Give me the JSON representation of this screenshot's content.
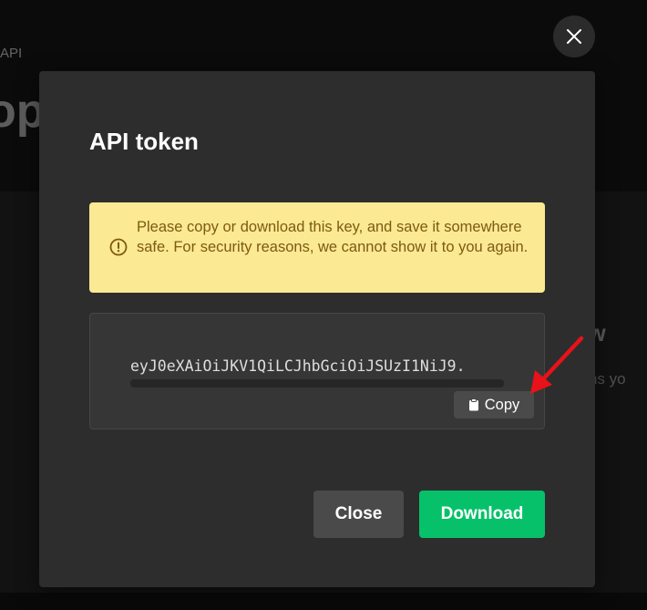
{
  "background": {
    "breadcrumb": "API",
    "big_title": "ope",
    "side_heading": "ow",
    "side_text": "kens yo"
  },
  "modal": {
    "title": "API token",
    "warning": "Please copy or download this key, and save it somewhere safe. For security reasons, we cannot show it to you again.",
    "token": "eyJ0eXAiOiJKV1QiLCJhbGciOiJSUzI1NiJ9.",
    "copy_label": "Copy",
    "close_label": "Close",
    "download_label": "Download"
  },
  "colors": {
    "warning_bg": "#fbe994",
    "warning_text": "#7d5a11",
    "primary": "#07c16a",
    "annotation_arrow": "#e8121a"
  },
  "icons": [
    "close-icon",
    "warning-icon",
    "clipboard-icon",
    "annotation-arrow"
  ]
}
